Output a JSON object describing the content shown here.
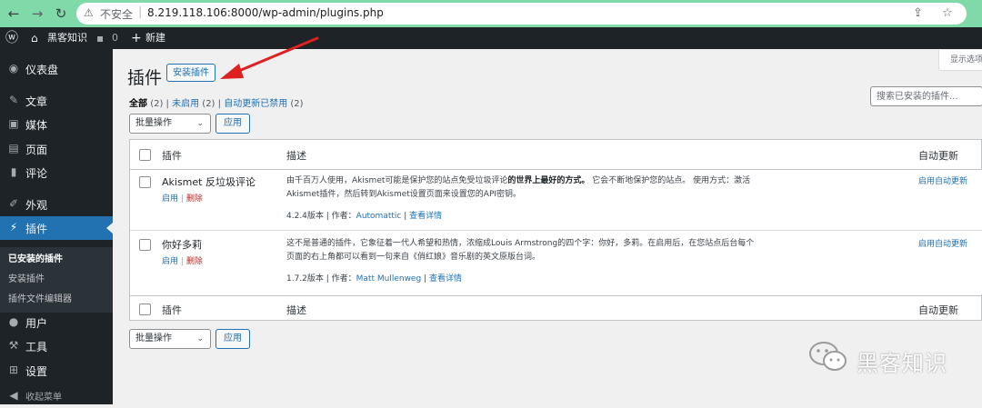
{
  "browser": {
    "insecure_label": "不安全",
    "url": "8.219.118.106:8000/wp-admin/plugins.php",
    "icons": [
      "back-arrow-icon",
      "forward-arrow-icon",
      "reload-icon",
      "warning-icon",
      "share-icon",
      "star-icon"
    ]
  },
  "adminbar": {
    "site_name": "黑客知识",
    "comments_count": "0",
    "new_label": "新建"
  },
  "sidebar": {
    "items": [
      {
        "label": "仪表盘",
        "icon": "dashboard-icon"
      },
      {
        "label": "文章",
        "icon": "pin-icon"
      },
      {
        "label": "媒体",
        "icon": "media-icon"
      },
      {
        "label": "页面",
        "icon": "page-icon"
      },
      {
        "label": "评论",
        "icon": "comment-icon"
      },
      {
        "label": "外观",
        "icon": "brush-icon"
      },
      {
        "label": "插件",
        "icon": "plugin-icon"
      },
      {
        "label": "用户",
        "icon": "user-icon"
      },
      {
        "label": "工具",
        "icon": "wrench-icon"
      },
      {
        "label": "设置",
        "icon": "settings-icon"
      },
      {
        "label": "收起菜单",
        "icon": "collapse-icon"
      }
    ],
    "submenu": [
      "已安装的插件",
      "安装插件",
      "插件文件编辑器"
    ],
    "active_color": "#2271b1"
  },
  "screen_options": "显示选项",
  "page": {
    "title": "插件",
    "add_button": "安装插件",
    "filters": {
      "all": "全部",
      "all_count": "(2)",
      "inactive": "未启用",
      "inactive_count": "(2)",
      "auto_disabled": "自动更新已禁用",
      "auto_disabled_count": "(2)"
    },
    "search_placeholder": "搜索已安装的插件...",
    "bulk_label": "批量操作",
    "apply_label": "应用"
  },
  "table": {
    "col_plugin": "插件",
    "col_desc": "描述",
    "col_auto": "自动更新",
    "plugins": [
      {
        "name": "Akismet 反垃圾评论",
        "activate": "启用",
        "delete": "删除",
        "desc_before": "由千百万人使用，Akismet可能是保护您的站点免受垃圾评论",
        "desc_bold": "的世界上最好的方式。",
        "desc_after": "它会不断地保护您的站点。 使用方式：激活Akismet插件，然后转到Akismet设置页面来设置您的API密钥。",
        "version_text": "4.2.4版本 | 作者：",
        "author": "Automattic",
        "details": "查看详情",
        "auto_update": "启用自动更新"
      },
      {
        "name": "你好多莉",
        "activate": "启用",
        "delete": "删除",
        "desc_before": "这不是普通的插件，它象征着一代人希望和热情，浓缩成Louis Armstrong的四个字：你好，多莉。在启用后，在您站点后台每个页面的右上角都可以看到一句来自《俏红娘》音乐剧的英文原版台词。",
        "desc_bold": "",
        "desc_after": "",
        "version_text": "1.7.2版本 | 作者：",
        "author": "Matt Mullenweg",
        "details": "查看详情",
        "auto_update": "启用自动更新"
      }
    ]
  },
  "watermark": {
    "text": "黑客知识",
    "icon": "wechat-icon"
  },
  "annotation": {
    "color": "#e02020",
    "icon": "red-arrow-annotation"
  }
}
